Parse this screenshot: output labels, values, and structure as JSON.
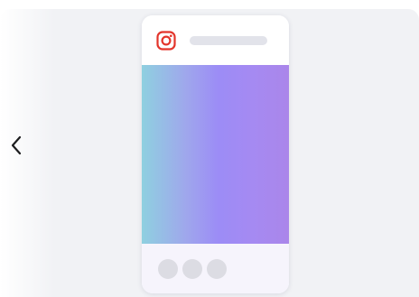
{
  "navigation": {
    "prev_icon": "chevron-left-icon"
  },
  "preview": {
    "platform_icon": "instagram-icon",
    "platform_color": "#e3352b",
    "image_gradient": [
      "#8fd0e0",
      "#9c8cf6",
      "#aa86ea"
    ],
    "placeholder_color": "#dcdce3",
    "footer_dots": 3
  }
}
